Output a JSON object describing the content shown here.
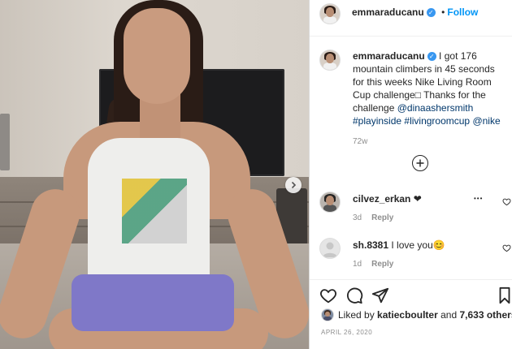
{
  "post": {
    "username": "emmaraducanu",
    "follow_label": "Follow",
    "separator": "•",
    "more_icon": "more-horizontal-icon"
  },
  "caption": {
    "username": "emmaraducanu",
    "text": "I got 176 mountain climbers in 45 seconds for this weeks Nike Living Room Cup challenge□ Thanks for the challenge",
    "tags": [
      "@dinaashersmith",
      "#playinside",
      "#livingroomcup",
      "@nike"
    ],
    "age": "72w"
  },
  "load_more_icon": "plus-circle-icon",
  "comments": [
    {
      "username": "cilvez_erkan",
      "text": "❤",
      "age": "3d",
      "reply_label": "Reply"
    },
    {
      "username": "sh.8381",
      "text": "I love you😊",
      "age": "1d",
      "reply_label": "Reply"
    }
  ],
  "comment_more": "•••",
  "likes": {
    "prefix": "Liked by",
    "user": "katiecboulter",
    "and": "and",
    "others": "7,633 others"
  },
  "date": "APRIL 26, 2020",
  "colors": {
    "accent": "#0095f6",
    "verified": "#3897f0",
    "muted": "#8e8e8e"
  }
}
